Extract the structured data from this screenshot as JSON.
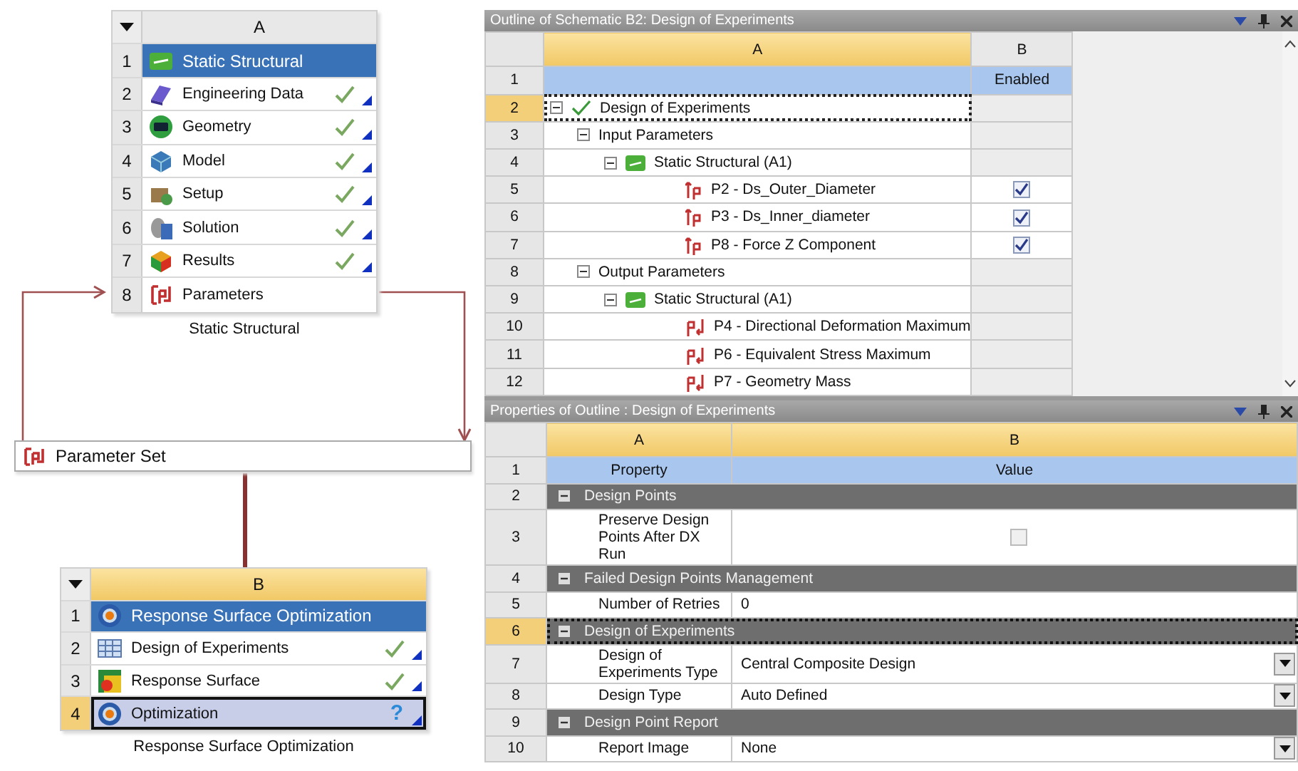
{
  "schematic": {
    "systems": [
      {
        "column_label": "A",
        "selected": false,
        "caption": "Static Structural",
        "cells": [
          {
            "number": "1",
            "label": "Static Structural",
            "kind": "system",
            "header": true,
            "selected": false
          },
          {
            "number": "2",
            "label": "Engineering Data",
            "kind": "engineering_data",
            "up_to_date": true,
            "selected": false
          },
          {
            "number": "3",
            "label": "Geometry",
            "kind": "geometry",
            "up_to_date": true,
            "selected": false
          },
          {
            "number": "4",
            "label": "Model",
            "kind": "model",
            "up_to_date": true,
            "selected": false
          },
          {
            "number": "5",
            "label": "Setup",
            "kind": "setup",
            "up_to_date": true,
            "selected": false
          },
          {
            "number": "6",
            "label": "Solution",
            "kind": "solution",
            "up_to_date": true,
            "selected": false
          },
          {
            "number": "7",
            "label": "Results",
            "kind": "results",
            "up_to_date": true,
            "selected": false
          },
          {
            "number": "8",
            "label": "Parameters",
            "kind": "parameters",
            "selected": false
          }
        ]
      },
      {
        "column_label": "B",
        "selected": true,
        "caption": "Response Surface Optimization",
        "cells": [
          {
            "number": "1",
            "label": "Response Surface Optimization",
            "kind": "optimization",
            "header": true,
            "selected": false
          },
          {
            "number": "2",
            "label": "Design of Experiments",
            "kind": "doe",
            "up_to_date": true,
            "selected": false
          },
          {
            "number": "3",
            "label": "Response Surface",
            "kind": "response_surface",
            "up_to_date": true,
            "selected": false
          },
          {
            "number": "4",
            "label": "Optimization",
            "kind": "optimization",
            "up_to_date": false,
            "symbol": "?",
            "selected": true
          }
        ]
      }
    ],
    "parameter_set": {
      "label": "Parameter Set"
    }
  },
  "outline": {
    "title": "Outline of Schematic B2: Design of Experiments",
    "columns": [
      "A",
      "B"
    ],
    "header_row": {
      "number": "1",
      "enabled_label": "Enabled"
    },
    "tree": [
      {
        "number": "2",
        "label": "Design of Experiments",
        "up_to_date": true,
        "expanded": true,
        "selected": true,
        "children": [
          {
            "number": "3",
            "label": "Input Parameters",
            "expanded": true,
            "selected": false,
            "children": [
              {
                "number": "4",
                "label": "Static Structural (A1)",
                "kind": "system",
                "expanded": true,
                "selected": false,
                "children": [
                  {
                    "number": "5",
                    "label": "P2 - Ds_Outer_Diameter",
                    "kind": "input_param",
                    "enabled": true,
                    "selected": false
                  },
                  {
                    "number": "6",
                    "label": "P3 - Ds_Inner_diameter",
                    "kind": "input_param",
                    "enabled": true,
                    "selected": false
                  },
                  {
                    "number": "7",
                    "label": "P8 - Force Z Component",
                    "kind": "input_param",
                    "enabled": true,
                    "selected": false
                  }
                ]
              }
            ]
          },
          {
            "number": "8",
            "label": "Output Parameters",
            "expanded": true,
            "selected": false,
            "children": [
              {
                "number": "9",
                "label": "Static Structural (A1)",
                "kind": "system",
                "expanded": true,
                "selected": false,
                "children": [
                  {
                    "number": "10",
                    "label": "P4 - Directional Deformation Maximum",
                    "kind": "output_param",
                    "selected": false
                  },
                  {
                    "number": "11",
                    "label": "P6 - Equivalent Stress Maximum",
                    "kind": "output_param",
                    "selected": false
                  },
                  {
                    "number": "12",
                    "label": "P7 - Geometry Mass",
                    "kind": "output_param",
                    "selected": false
                  }
                ]
              }
            ]
          }
        ]
      }
    ]
  },
  "properties": {
    "title": "Properties of Outline : Design of Experiments",
    "columns": [
      "A",
      "B"
    ],
    "header_row": {
      "number": "1",
      "labels": [
        "Property",
        "Value"
      ]
    },
    "rows": [
      {
        "number": "2",
        "kind": "section",
        "label": "Design Points",
        "expanded": true,
        "selected": false
      },
      {
        "number": "3",
        "kind": "checkbox",
        "label": "Preserve Design Points After DX Run",
        "checked": false,
        "selected": false
      },
      {
        "number": "4",
        "kind": "section",
        "label": "Failed Design Points Management",
        "expanded": true,
        "selected": false
      },
      {
        "number": "5",
        "kind": "text",
        "label": "Number of Retries",
        "value": "0",
        "selected": false
      },
      {
        "number": "6",
        "kind": "section",
        "label": "Design of Experiments",
        "expanded": true,
        "selected": true
      },
      {
        "number": "7",
        "kind": "dropdown",
        "label": "Design of Experiments Type",
        "value": "Central Composite Design",
        "selected": false
      },
      {
        "number": "8",
        "kind": "dropdown",
        "label": "Design Type",
        "value": "Auto Defined",
        "selected": false
      },
      {
        "number": "9",
        "kind": "section",
        "label": "Design Point Report",
        "expanded": true,
        "selected": false
      },
      {
        "number": "10",
        "kind": "dropdown",
        "label": "Report Image",
        "value": "None",
        "selected": false
      }
    ]
  }
}
